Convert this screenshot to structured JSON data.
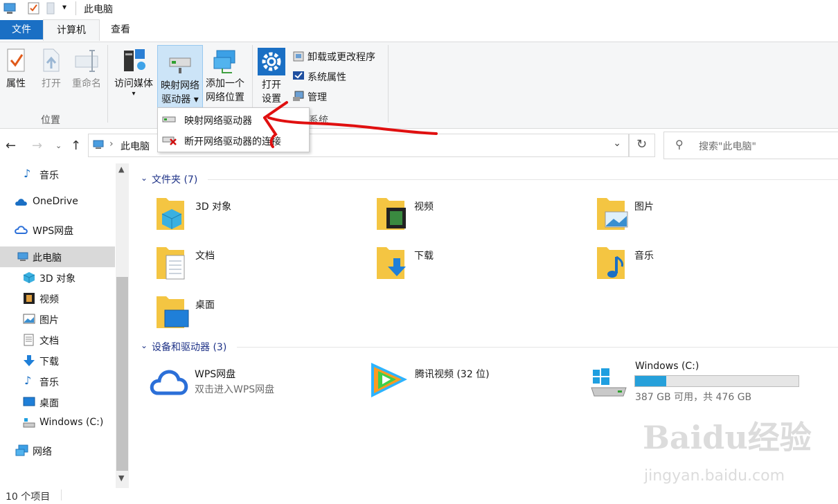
{
  "window": {
    "title": "此电脑"
  },
  "ribbon_tabs": {
    "file": "文件",
    "computer": "计算机",
    "view": "查看"
  },
  "ribbon": {
    "properties": "属性",
    "open": "打开",
    "rename": "重命名",
    "location_group": "位置",
    "access_media": "访问媒体",
    "map_drive_l1": "映射网络",
    "map_drive_l2": "驱动器",
    "add_location_l1": "添加一个",
    "add_location_l2": "网络位置",
    "open_settings_l1": "打开",
    "open_settings_l2": "设置",
    "uninstall": "卸载或更改程序",
    "system_properties": "系统属性",
    "manage": "管理",
    "system_group": "系统"
  },
  "dropdown": {
    "map_drive": "映射网络驱动器",
    "disconnect": "断开网络驱动器的连接"
  },
  "address": {
    "path": "此电脑",
    "search_placeholder": "搜索\"此电脑\""
  },
  "nav_pane": {
    "music_top": "音乐",
    "onedrive": "OneDrive",
    "wps": "WPS网盘",
    "this_pc": "此电脑",
    "objects3d": "3D 对象",
    "videos": "视频",
    "pictures": "图片",
    "documents": "文档",
    "downloads": "下载",
    "music": "音乐",
    "desktop": "桌面",
    "windows_c": "Windows (C:)",
    "network": "网络"
  },
  "folders": {
    "header": "文件夹 (7)",
    "items": [
      "3D 对象",
      "视频",
      "图片",
      "文档",
      "下载",
      "音乐",
      "桌面"
    ]
  },
  "devices": {
    "header": "设备和驱动器 (3)",
    "wps_name": "WPS网盘",
    "wps_sub": "双击进入WPS网盘",
    "tencent": "腾讯视频 (32 位)",
    "drive_name": "Windows (C:)",
    "drive_sub": "387 GB 可用，共 476 GB",
    "drive_used_fraction": 0.19
  },
  "status": {
    "count": "10 个项目"
  },
  "watermark": {
    "main": "Baidu经验",
    "sub": "jingyan.baidu.com"
  },
  "colors": {
    "accent": "#1a6fc4",
    "annotation": "#e01010",
    "folder": "#f4c542"
  }
}
